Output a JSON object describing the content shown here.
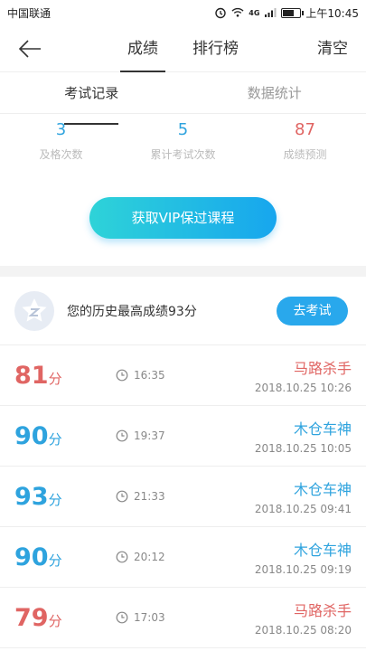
{
  "status_bar": {
    "carrier": "中国联通",
    "time": "上午10:45",
    "network": "4G"
  },
  "nav": {
    "tabs": [
      {
        "label": "成绩",
        "active": true
      },
      {
        "label": "排行榜",
        "active": false
      }
    ],
    "clear_label": "清空"
  },
  "sub_tabs": [
    {
      "label": "考试记录",
      "active": true
    },
    {
      "label": "数据统计",
      "active": false
    }
  ],
  "stats": [
    {
      "value": "3",
      "label": "及格次数",
      "color": "#2ea3de"
    },
    {
      "value": "5",
      "label": "累计考试次数",
      "color": "#2ea3de"
    },
    {
      "value": "87",
      "label": "成绩预测",
      "color": "#e06563"
    }
  ],
  "vip_button": "获取VIP保过课程",
  "best": {
    "text": "您的历史最高成绩93分",
    "button": "去考试",
    "badge_icon": "star-badge-icon"
  },
  "records": [
    {
      "score": "81",
      "unit": "分",
      "duration": "16:35",
      "title": "马路杀手",
      "datetime": "2018.10.25  10:26",
      "tone": "red"
    },
    {
      "score": "90",
      "unit": "分",
      "duration": "19:37",
      "title": "木仓车神",
      "datetime": "2018.10.25  10:05",
      "tone": "blue"
    },
    {
      "score": "93",
      "unit": "分",
      "duration": "21:33",
      "title": "木仓车神",
      "datetime": "2018.10.25  09:41",
      "tone": "blue"
    },
    {
      "score": "90",
      "unit": "分",
      "duration": "20:12",
      "title": "木仓车神",
      "datetime": "2018.10.25  09:19",
      "tone": "blue"
    },
    {
      "score": "79",
      "unit": "分",
      "duration": "17:03",
      "title": "马路杀手",
      "datetime": "2018.10.25  08:20",
      "tone": "red"
    }
  ],
  "colors": {
    "pass_red": "#e06563",
    "accent_blue": "#2ea3de",
    "exam_button": "#29a8ec"
  }
}
